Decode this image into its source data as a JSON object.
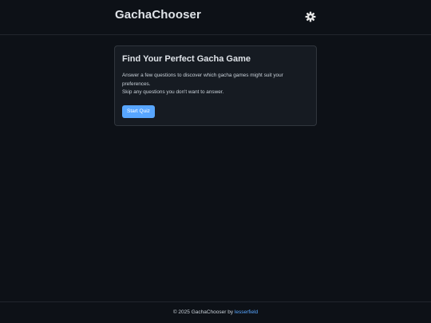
{
  "header": {
    "title": "GachaChooser",
    "settings_icon": "gear-icon"
  },
  "intro": {
    "title": "Find Your Perfect Gacha Game",
    "line1": "Answer a few questions to discover which gacha games might suit your preferences.",
    "line2": "Skip any questions you don't want to answer.",
    "button_label": "Start Quiz"
  },
  "footer": {
    "prefix": "© 2025 GachaChooser by",
    "author": "lesserfield"
  },
  "colors": {
    "background": "#0d1117",
    "card": "#161b22",
    "accent": "#58a6ff"
  }
}
